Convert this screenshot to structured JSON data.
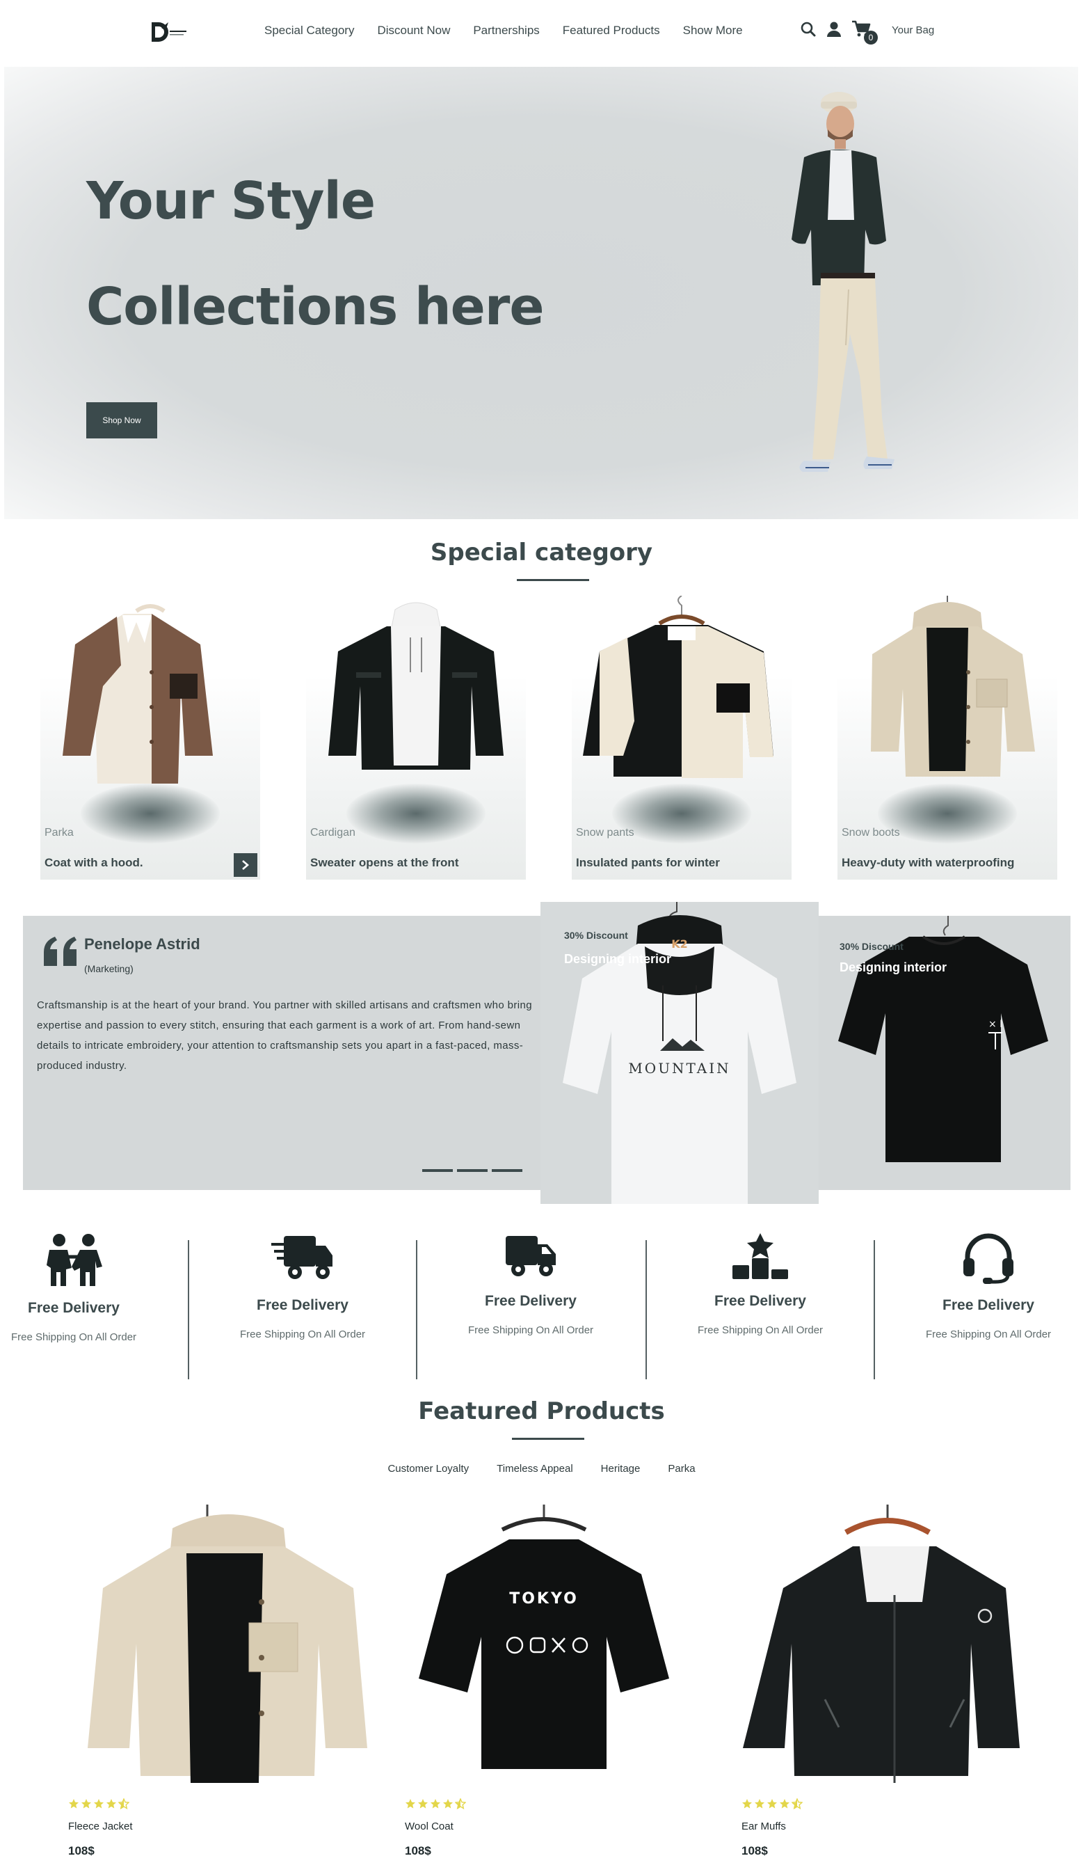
{
  "nav": {
    "links": [
      "Special Category",
      "Discount Now",
      "Partnerships",
      "Featured Products",
      "Show More"
    ],
    "icons": [
      "search-icon",
      "user-icon",
      "cart-icon"
    ],
    "cart_count": "0",
    "bag_label": "Your Bag"
  },
  "hero": {
    "line1": "Your Style",
    "line2": "Collections here",
    "cta": "Shop Now"
  },
  "special": {
    "title": "Special category",
    "cards": [
      {
        "label": "Parka",
        "title": "Coat with a hood."
      },
      {
        "label": "Cardigan",
        "title": "Sweater opens at the front"
      },
      {
        "label": "Snow pants",
        "title": "Insulated pants for winter"
      },
      {
        "label": "Snow boots",
        "title": "Heavy-duty with waterproofing"
      }
    ]
  },
  "testimonial": {
    "name": "Penelope Astrid",
    "role": "(Marketing)",
    "text": "Craftsmanship is at the heart of your brand. You partner with skilled artisans and craftsmen who bring expertise and passion to every stitch, ensuring that each garment is a work of art. From hand-sewn details to intricate embroidery, your attention to craftsmanship sets you apart in a fast-paced, mass-produced industry."
  },
  "promos": [
    {
      "discount": "30% Discount",
      "heading": "Designing interior",
      "print": "MOUNTAIN",
      "hanger_brand": "K2"
    },
    {
      "discount": "30% Discount",
      "heading": "Designing interior"
    }
  ],
  "features": [
    {
      "icon": "people-icon",
      "title": "Free Delivery",
      "text": "Free Shipping On All Order"
    },
    {
      "icon": "fast-truck-icon",
      "title": "Free Delivery",
      "text": "Free Shipping On All Order"
    },
    {
      "icon": "truck-icon",
      "title": "Free Delivery",
      "text": "Free Shipping On All Order"
    },
    {
      "icon": "podium-star-icon",
      "title": "Free Delivery",
      "text": "Free Shipping On All Order"
    },
    {
      "icon": "headset-icon",
      "title": "Free Delivery",
      "text": "Free Shipping On All Order"
    }
  ],
  "featured": {
    "title": "Featured Products",
    "tabs": [
      "Customer Loyalty",
      "Timeless Appeal",
      "Heritage",
      "Parka"
    ],
    "products": [
      {
        "name": "Fleece Jacket",
        "price": "108$",
        "rating": 4.5
      },
      {
        "name": "Wool Coat",
        "price": "108$",
        "rating": 4.5,
        "print": "TOKYO"
      },
      {
        "name": "Ear Muffs",
        "price": "108$",
        "rating": 4.5
      }
    ]
  },
  "colors": {
    "primary": "#3c4a4c",
    "panel": "#d4d8d9",
    "star": "#e3d64a"
  }
}
